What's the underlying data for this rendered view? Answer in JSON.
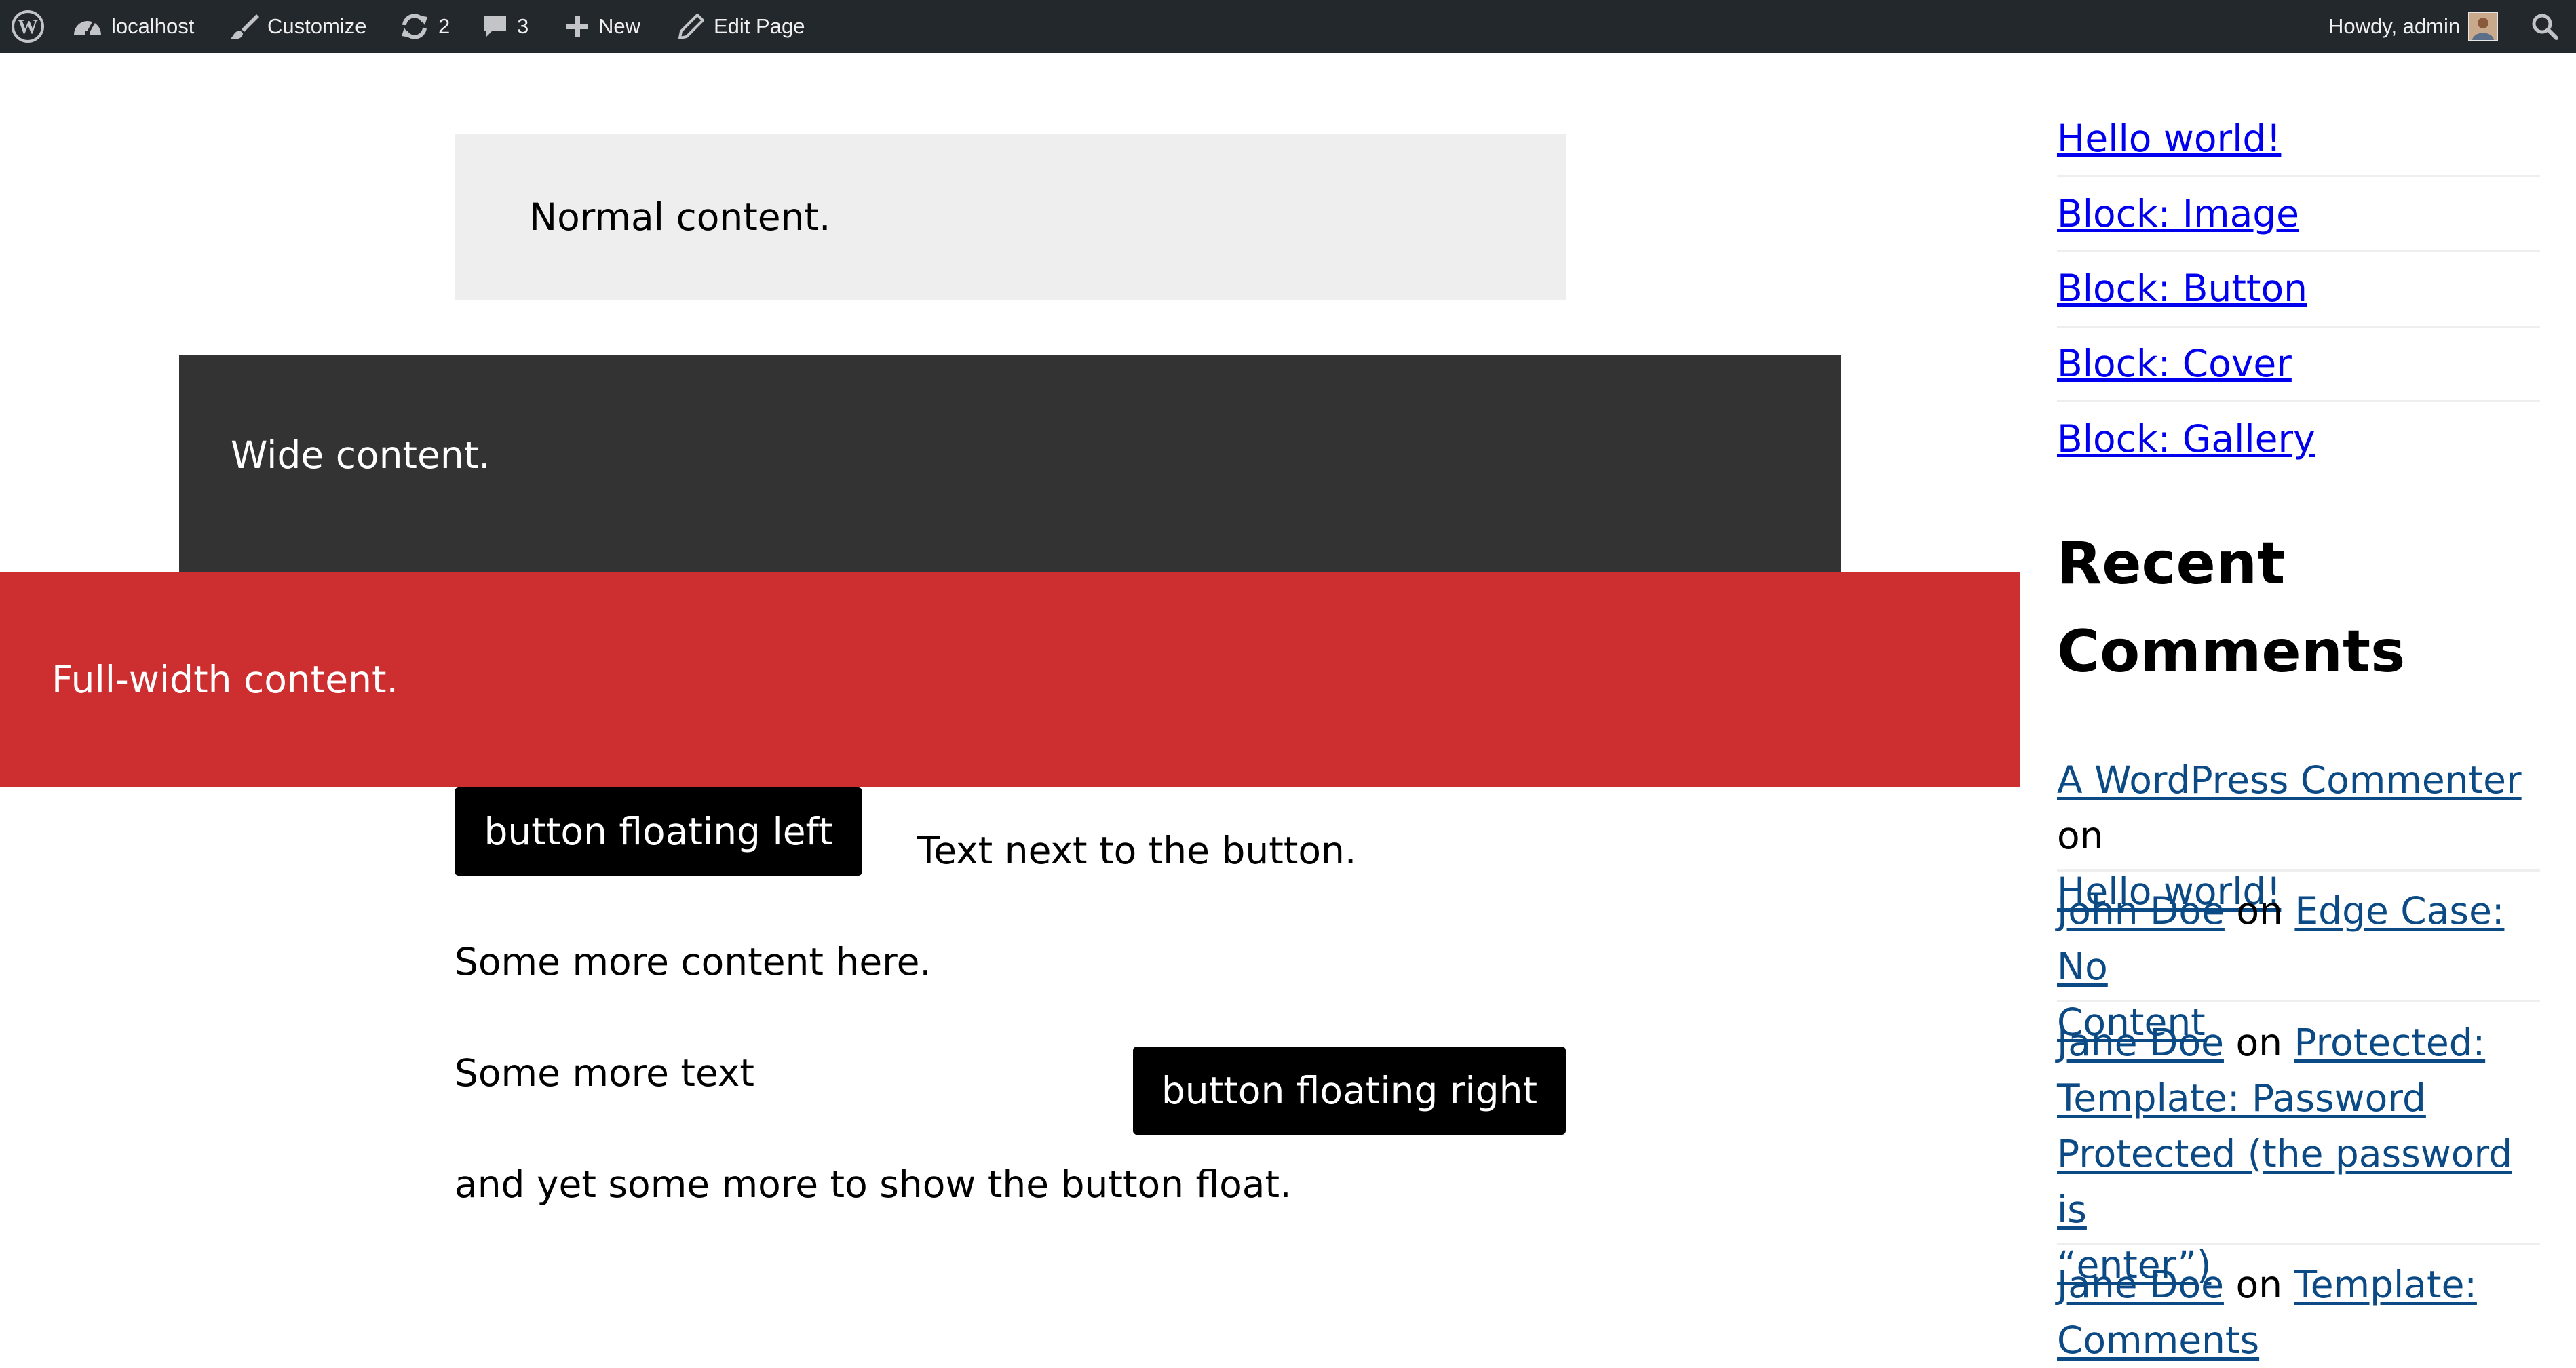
{
  "admin_bar": {
    "site_name": "localhost",
    "customize": "Customize",
    "updates_count": "2",
    "comments_count": "3",
    "new_label": "New",
    "edit_page": "Edit Page",
    "howdy": "Howdy, admin"
  },
  "content": {
    "normal": "Normal content.",
    "wide": "Wide content.",
    "full": "Full-width content.",
    "button_left": "button floating left",
    "text_next": "Text next to the button.",
    "more_content": "Some more content here.",
    "more_text": "Some more text",
    "button_right": "button floating right",
    "yet_more": "and yet some more to show the button float."
  },
  "sidebar": {
    "recent_posts": [
      "Hello world!",
      "Block: Image",
      "Block: Button",
      "Block: Cover",
      "Block: Gallery"
    ],
    "recent_comments_title_line1": "Recent",
    "recent_comments_title_line2": "Comments",
    "comments": [
      {
        "author": "A WordPress Commenter",
        "on": "on",
        "post_lines": [
          "Hello world!"
        ]
      },
      {
        "author": "John Doe",
        "on": "on",
        "post_lines": [
          "Edge Case: No",
          "Content"
        ]
      },
      {
        "author": "Jane Doe",
        "on": "on",
        "post_lines": [
          "Protected:",
          "Template: Password",
          "Protected (the password is",
          "“enter”)"
        ]
      },
      {
        "author": "Jane Doe",
        "on": "on",
        "post_lines": [
          "Template:",
          "Comments"
        ]
      }
    ]
  },
  "colors": {
    "admin_bar_bg": "#23282d",
    "normal_bg": "#eeeeee",
    "wide_bg": "#333333",
    "full_bg": "#cd2e2f",
    "link": "#0b4a84"
  },
  "icons": {
    "wordpress": "wordpress-logo-icon",
    "dashboard": "dashboard-icon",
    "customize": "paintbrush-icon",
    "updates": "refresh-icon",
    "comments": "speech-bubble-icon",
    "new": "plus-icon",
    "edit": "pencil-icon",
    "search": "search-icon"
  }
}
